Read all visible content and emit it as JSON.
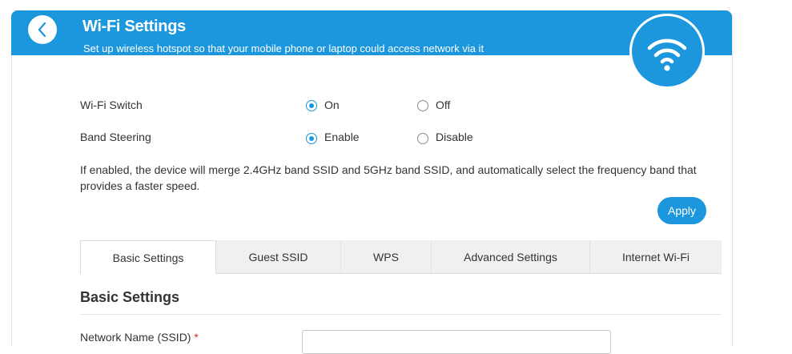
{
  "header": {
    "title": "Wi-Fi Settings",
    "subtitle": "Set up wireless hotspot so that your mobile phone or laptop could access network via it",
    "back_icon": "chevron-left-icon",
    "badge_icon": "wifi-icon",
    "accent_color": "#1c97dd"
  },
  "wifi_switch": {
    "label": "Wi-Fi Switch",
    "options": [
      "On",
      "Off"
    ],
    "selected": "On"
  },
  "band_steering": {
    "label": "Band Steering",
    "options": [
      "Enable",
      "Disable"
    ],
    "selected": "Enable",
    "note": "If enabled, the device will merge 2.4GHz band SSID and 5GHz band SSID, and automatically select the frequency band that provides a faster speed."
  },
  "apply_label": "Apply",
  "tabs": [
    {
      "label": "Basic Settings",
      "active": true
    },
    {
      "label": "Guest SSID",
      "active": false
    },
    {
      "label": "WPS",
      "active": false
    },
    {
      "label": "Advanced Settings",
      "active": false
    },
    {
      "label": "Internet Wi-Fi",
      "active": false
    }
  ],
  "section": {
    "title": "Basic Settings",
    "field_label": "Network Name (SSID)",
    "required_mark": "*",
    "field_value": ""
  }
}
